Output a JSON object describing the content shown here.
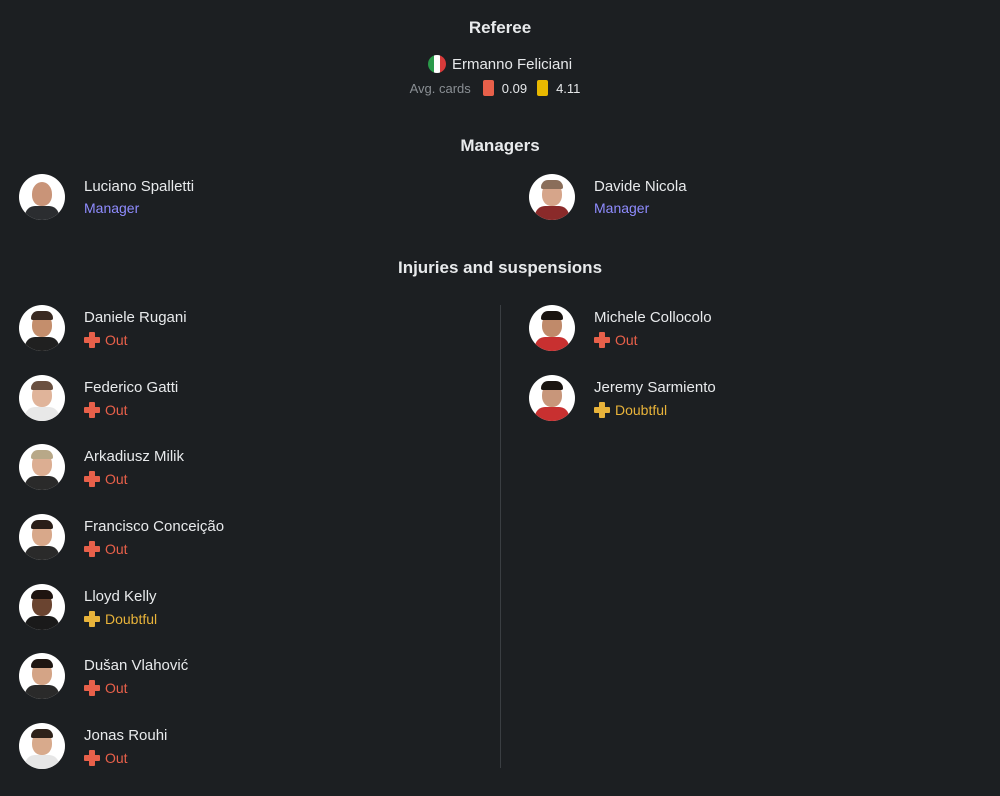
{
  "referee": {
    "title": "Referee",
    "name": "Ermanno Feliciani",
    "flag_icon": "italy-flag-icon",
    "flag_colors": [
      "#2a9a4a",
      "#ffffff",
      "#d83a3a"
    ],
    "avg_cards_label": "Avg. cards",
    "red_avg": "0.09",
    "yellow_avg": "4.11",
    "red_color": "#e8604a",
    "yellow_color": "#e8b800"
  },
  "managers": {
    "title": "Managers",
    "home": {
      "name": "Luciano Spalletti",
      "role": "Manager"
    },
    "away": {
      "name": "Davide Nicola",
      "role": "Manager"
    }
  },
  "injuries": {
    "title": "Injuries and suspensions",
    "home": [
      {
        "name": "Daniele Rugani",
        "status": "Out"
      },
      {
        "name": "Federico Gatti",
        "status": "Out"
      },
      {
        "name": "Arkadiusz Milik",
        "status": "Out"
      },
      {
        "name": "Francisco Conceição",
        "status": "Out"
      },
      {
        "name": "Lloyd Kelly",
        "status": "Doubtful"
      },
      {
        "name": "Dušan Vlahović",
        "status": "Out"
      },
      {
        "name": "Jonas Rouhi",
        "status": "Out"
      }
    ],
    "away": [
      {
        "name": "Michele Collocolo",
        "status": "Out"
      },
      {
        "name": "Jeremy Sarmiento",
        "status": "Doubtful"
      }
    ]
  },
  "colors": {
    "background": "#1c1f22",
    "role_accent": "#8f8cff",
    "out": "#e8604a",
    "doubtful": "#e8b33a"
  }
}
